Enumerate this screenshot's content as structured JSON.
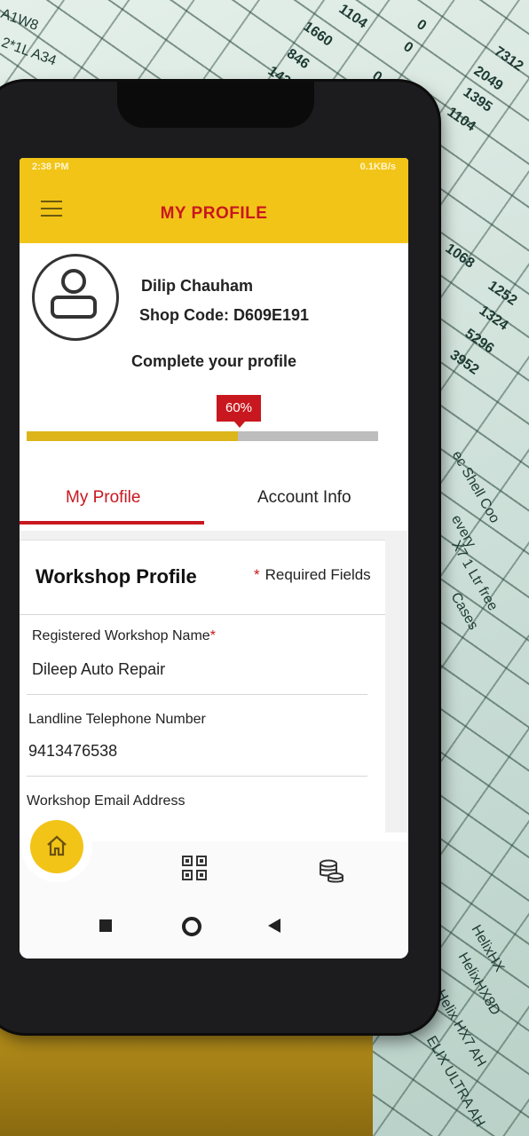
{
  "status_bar": {
    "time": "2:38 PM",
    "indicators": "0.1KB/s"
  },
  "header": {
    "title": "MY PROFILE",
    "menu_icon": "hamburger-menu-icon"
  },
  "profile": {
    "name": "Dilip Chauham",
    "shop_code": "Shop Code: D609E191",
    "complete_prompt": "Complete your profile",
    "completion_label": "60%",
    "completion_fraction": 0.6
  },
  "tabs": [
    {
      "label": "My Profile",
      "active": true
    },
    {
      "label": "Account Info",
      "active": false
    }
  ],
  "workshop_card": {
    "title": "Workshop Profile",
    "required_note": "Required Fields",
    "fields": [
      {
        "label": "Registered Workshop Name",
        "required": true,
        "value": "Dileep Auto Repair"
      },
      {
        "label": "Landline Telephone Number",
        "required": false,
        "value": "9413476538"
      },
      {
        "label": "Workshop Email Address",
        "required": false,
        "value": ""
      }
    ]
  },
  "bottom_nav": {
    "items": [
      "home-icon",
      "qr-code-icon",
      "coins-icon"
    ]
  },
  "colors": {
    "brand_yellow": "#f2c417",
    "accent_red": "#c8171e"
  },
  "background_sheet": {
    "numbers": [
      "1104",
      "1660",
      "846",
      "1435",
      "0",
      "0",
      "0",
      "7312",
      "2049",
      "1395",
      "1104",
      "1068",
      "1252",
      "1324",
      "5296",
      "3952"
    ],
    "text": [
      "ec Shell Coo",
      "every",
      "X7 1 Ltr free",
      "Cases",
      "HelixHX",
      "HelixHX8D",
      "Helix HX7 AH",
      "ELIX ULTRA AH",
      "A1W8",
      "2*1L A34"
    ]
  }
}
